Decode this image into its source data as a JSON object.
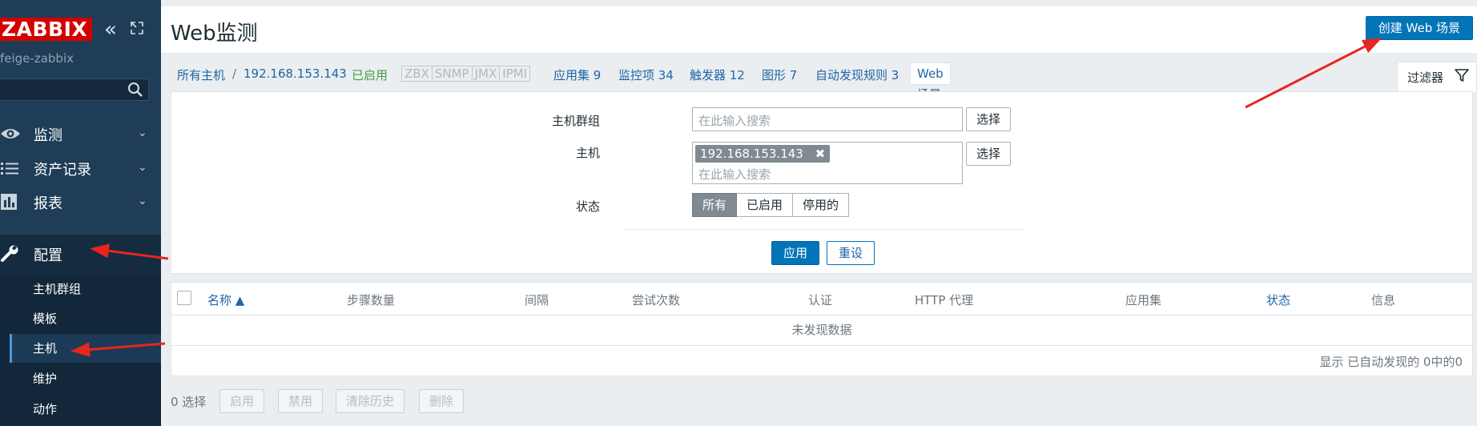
{
  "sidebar": {
    "logo": "ZABBIX",
    "server_name": "feige-zabbix",
    "collapse_glyph": "«",
    "menu": [
      {
        "label": "监测",
        "icon": "eye-icon"
      },
      {
        "label": "资产记录",
        "icon": "list-icon"
      },
      {
        "label": "报表",
        "icon": "bar-chart-icon"
      },
      {
        "label": "配置",
        "icon": "wrench-icon"
      }
    ],
    "chevron": "⌄",
    "submenu": [
      "主机群组",
      "模板",
      "主机",
      "维护",
      "动作"
    ]
  },
  "header": {
    "title": "Web监测",
    "create_button": "创建 Web 场景"
  },
  "nav": {
    "all_hosts": "所有主机",
    "separator": "/",
    "host": "192.168.153.143",
    "enabled": "已启用",
    "protocols": [
      "ZBX",
      "SNMP",
      "JMX",
      "IPMI"
    ],
    "applications": "应用集 9",
    "items": "监控项 34",
    "triggers": "触发器 12",
    "graphs": "图形 7",
    "discovery": "自动发现规则 3",
    "web": "Web 场景"
  },
  "filter": {
    "tab_label": "过滤器",
    "host_group_label": "主机群组",
    "host_group_placeholder": "在此输入搜索",
    "host_label": "主机",
    "host_tag": "192.168.153.143",
    "tag_remove": "✖",
    "host_placeholder": "在此输入搜索",
    "select_button": "选择",
    "status_label": "状态",
    "status_options": [
      "所有",
      "已启用",
      "停用的"
    ],
    "apply": "应用",
    "reset": "重设"
  },
  "table": {
    "columns": [
      "名称 ▲",
      "步骤数量",
      "间隔",
      "尝试次数",
      "认证",
      "HTTP 代理",
      "应用集",
      "状态",
      "信息"
    ],
    "no_data": "未发现数据",
    "paging": "显示 已自动发现的 0中的0"
  },
  "bottom": {
    "selected": "0 选择",
    "buttons": [
      "启用",
      "禁用",
      "清除历史",
      "删除"
    ]
  },
  "colors": {
    "sidebar": "#1f3d57",
    "accent": "#0275b8",
    "logo": "#d40000",
    "annotation_arrow": "#e8251f"
  }
}
